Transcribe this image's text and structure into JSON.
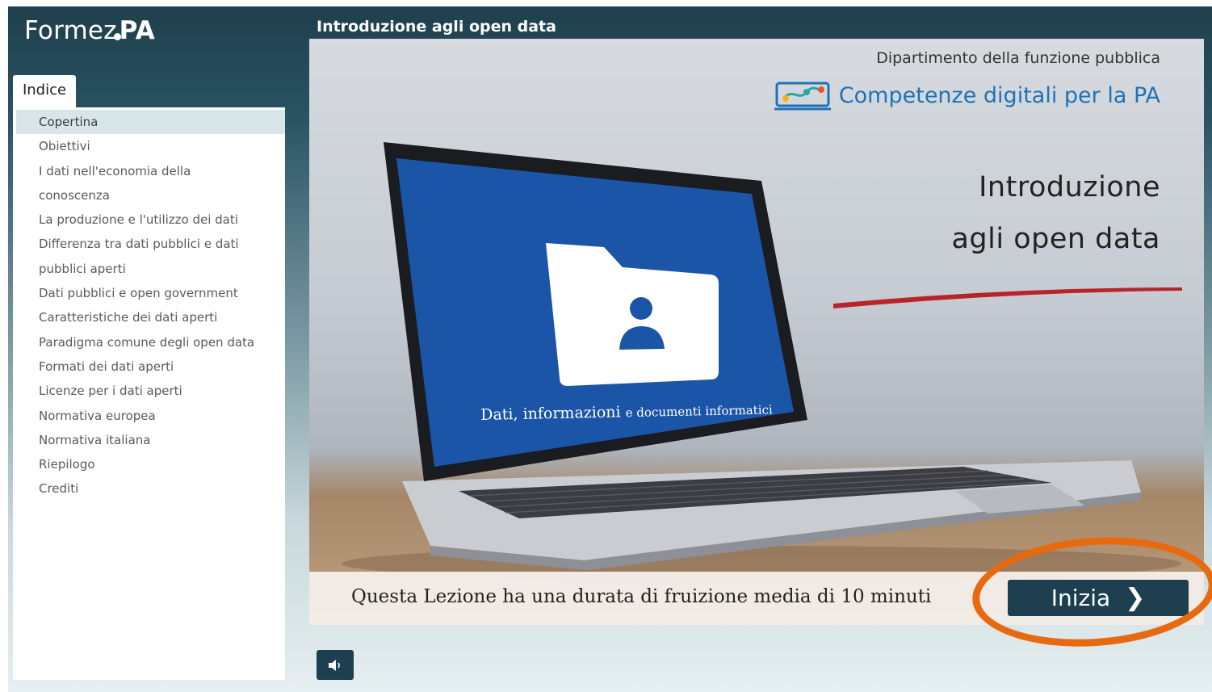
{
  "app": {
    "logo_prefix": "Formez",
    "logo_suffix": "PA",
    "course_title": "Introduzione agli open data"
  },
  "sidebar": {
    "tab_label": "Indice",
    "items": [
      {
        "label": "Copertina",
        "selected": true
      },
      {
        "label": "Obiettivi"
      },
      {
        "label": "I dati nell'economia della"
      },
      {
        "label": "conoscenza"
      },
      {
        "label": "La produzione e l'utilizzo dei dati"
      },
      {
        "label": "Differenza tra dati pubblici e dati"
      },
      {
        "label": "pubblici aperti"
      },
      {
        "label": "Dati pubblici e open government"
      },
      {
        "label": "Caratteristiche dei dati aperti"
      },
      {
        "label": "Paradigma comune degli open data"
      },
      {
        "label": "Formati dei dati aperti"
      },
      {
        "label": "Licenze per i dati aperti"
      },
      {
        "label": "Normativa europea"
      },
      {
        "label": "Normativa italiana"
      },
      {
        "label": "Riepilogo"
      },
      {
        "label": "Crediti"
      }
    ]
  },
  "slide": {
    "department": "Dipartimento della funzione pubblica",
    "brand": "Competenze digitali per la PA",
    "title_line1": "Introduzione",
    "title_line2": "agli open data",
    "screen_caption_main": "Dati, informazioni ",
    "screen_caption_small": "e documenti informatici",
    "duration_text": "Questa Lezione ha una durata di fruizione media di 10 minuti",
    "start_label": "Inizia",
    "start_icon": "chevron-right-icon"
  },
  "controls": {
    "audio_icon": "speaker-icon"
  },
  "colors": {
    "accent": "#1d3f4f",
    "brand_blue": "#1e73b7",
    "stroke_red": "#b8242a",
    "highlight_orange": "#e86a10",
    "screen_blue": "#1a55a8"
  }
}
